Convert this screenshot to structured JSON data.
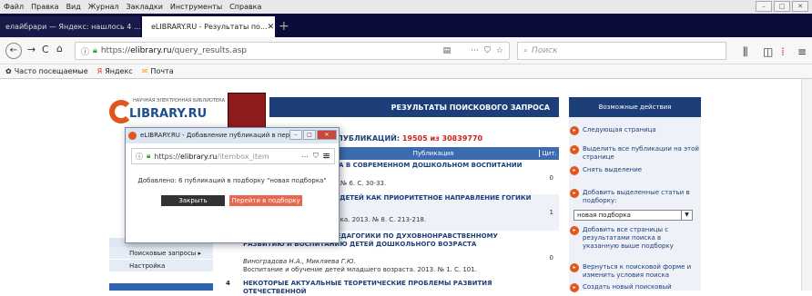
{
  "menubar": {
    "items": [
      "Файл",
      "Правка",
      "Вид",
      "Журнал",
      "Закладки",
      "Инструменты",
      "Справка"
    ]
  },
  "tabs": [
    {
      "label": "елайбрари — Яндекс: нашлось 4 ..."
    },
    {
      "label": "eLIBRARY.RU - Результаты по..."
    }
  ],
  "nav": {
    "url_prefix": "https://",
    "url_domain": "elibrary.ru",
    "url_path": "/query_results.asp",
    "search_placeholder": "Поиск"
  },
  "bookmarks": [
    "Часто посещаемые",
    "Яндекс",
    "Почта"
  ],
  "logo": {
    "line1": "НАУЧНАЯ ЭЛЕКТРОННАЯ БИБЛИОТЕКА",
    "line2": "LIBRARY.RU"
  },
  "results": {
    "header": "РЕЗУЛЬТАТЫ ПОИСКОВОГО ЗАПРОСА",
    "counts_label": "ПУБЛИКАЦИЙ:",
    "count_found": "19505",
    "count_sep": "из",
    "count_total": "30839770",
    "col_pub": "Публикация",
    "col_cit": "Цит.",
    "rows": [
      {
        "num": "",
        "title": "МА В СОВРЕМЕННОМ ДОШКОЛЬНОМ ВОСПИТАНИИ",
        "authors": "",
        "source": "3. № 6. С. 30-33.",
        "cit": "0"
      },
      {
        "num": "",
        "title": "Й ДЕТЕЙ КАК ПРИОРИТЕТНОЕ НАПРАВЛЕНИЕ ГОГИКИ",
        "authors": "",
        "source": "тика. 2013. № 8. С. 213-218.",
        "cit": "1"
      },
      {
        "num": "",
        "title": "ГОТОВКЕ БАКАЛАВРОВ ПЕДАГОГИКИ ПО ДУХОВНОНРАВСТВЕННОМУ РАЗВИТИЮ И ВОСПИТАНИЮ ДЕТЕЙ ДОШКОЛЬНОГО ВОЗРАСТА",
        "authors": "Виноградова Н.А., Микляева Г.Ю.",
        "source": "Воспитание и обучение детей младшего возраста. 2013. № 1. С. 101.",
        "cit": "0"
      },
      {
        "num": "4",
        "title": "НЕКОТОРЫЕ АКТУАЛЬНЫЕ ТЕОРЕТИЧЕСКИЕ ПРОБЛЕМЫ РАЗВИТИЯ ОТЕЧЕСТВЕННОЙ",
        "authors": "",
        "source": "",
        "cit": ""
      }
    ]
  },
  "leftmenu": {
    "items": [
      "Поисковые запросы ▸",
      "Настройка"
    ]
  },
  "rightpanel": {
    "header": "Возможные действия",
    "actions": [
      "Следующая страница",
      "Выделить все публикации на этой странице",
      "Снять выделение",
      "Добавить выделенные статьи в подборку:",
      "Добавить все страницы с результатами поиска в указанную выше подборку",
      "Вернуться к поисковой форме и изменить условия поиска",
      "Создать новый поисковый"
    ],
    "select_value": "новая подборка"
  },
  "popup": {
    "title": "eLIBRARY.RU - Добавление публикаций в пер...",
    "url_prefix": "https://",
    "url_domain": "elibrary.ru",
    "url_path": "/itembox_item",
    "message": "Добавлено: 6 публикаций в подборку \"новая подборка\"",
    "close_label": "Закрыть",
    "go_label": "Перейти в подборку"
  }
}
